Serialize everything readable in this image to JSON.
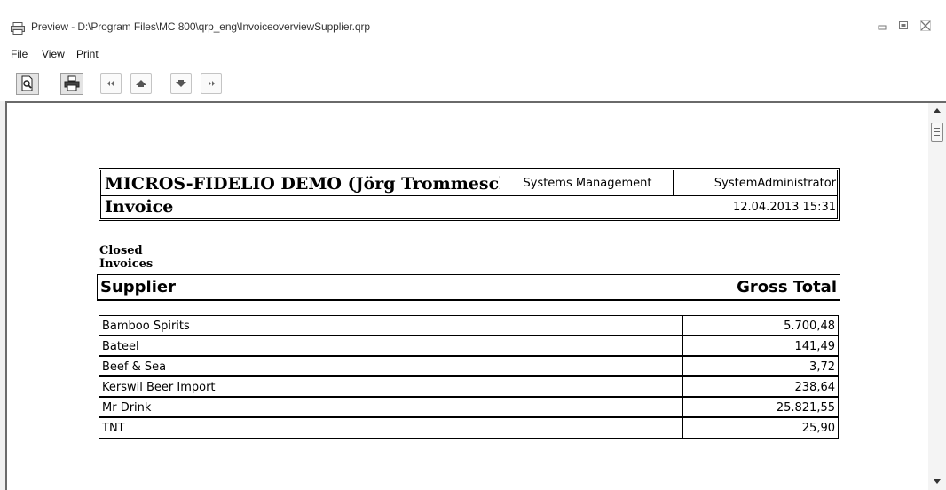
{
  "window": {
    "title": "Preview - D:\\Program Files\\MC 800\\qrp_eng\\InvoiceoverviewSupplier.qrp",
    "icon": "printer-icon",
    "controls": [
      "minimize-icon",
      "restore-icon",
      "close-icon"
    ]
  },
  "menu": {
    "items": [
      {
        "hotkey": "F",
        "rest": "ile"
      },
      {
        "hotkey": "V",
        "rest": "iew"
      },
      {
        "hotkey": "P",
        "rest": "rint"
      }
    ]
  },
  "toolbar": {
    "buttons": [
      "preview-icon",
      "print-icon",
      "first-page-icon",
      "previous-page-icon",
      "next-page-icon",
      "last-page-icon"
    ]
  },
  "report": {
    "company": "MICROS-FIDELIO DEMO (Jörg Trommeschl",
    "department": "Systems Management",
    "user": "SystemAdministrator",
    "report_name": "Invoice",
    "datetime": "12.04.2013 15:31",
    "section_title": "Closed Invoices",
    "columns": {
      "supplier": "Supplier",
      "gross_total": "Gross Total"
    },
    "rows": [
      {
        "supplier": "Bamboo Spirits",
        "gross_total": "5.700,48"
      },
      {
        "supplier": "Bateel",
        "gross_total": "141,49"
      },
      {
        "supplier": "Beef & Sea",
        "gross_total": "3,72"
      },
      {
        "supplier": "Kerswil Beer Import",
        "gross_total": "238,64"
      },
      {
        "supplier": "Mr Drink",
        "gross_total": "25.821,55"
      },
      {
        "supplier": "TNT",
        "gross_total": "25,90"
      }
    ]
  }
}
